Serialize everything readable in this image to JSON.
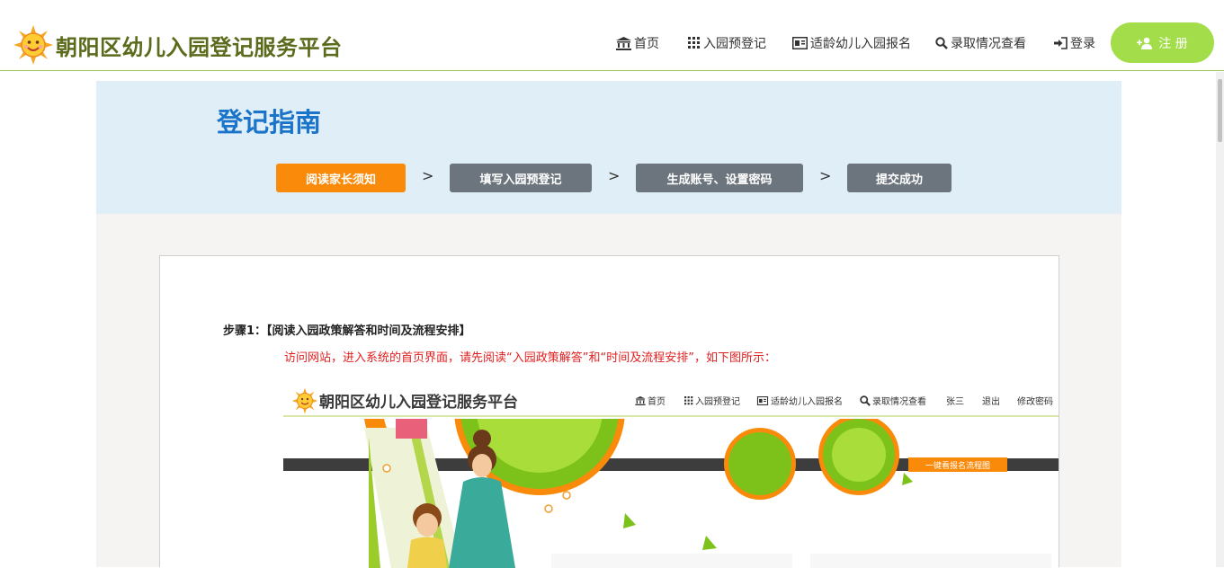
{
  "header": {
    "site_title": "朝阳区幼儿入园登记服务平台",
    "nav": {
      "home": "首页",
      "pre_register": "入园预登记",
      "age_apply": "适龄幼儿入园报名",
      "admission_query": "录取情况查看",
      "login": "登录",
      "register": "注 册"
    },
    "colors": {
      "title": "#5a6b1c",
      "register_button": "#a3dd4a",
      "divider": "#9ccc5a"
    }
  },
  "guide": {
    "title": "登记指南",
    "steps": [
      {
        "label": "阅读家长须知",
        "state": "active"
      },
      {
        "label": "填写入园预登记",
        "state": "inactive"
      },
      {
        "label": "生成账号、设置密码",
        "state": "inactive"
      },
      {
        "label": "提交成功",
        "state": "inactive"
      }
    ],
    "separator": ">",
    "colors": {
      "active": "#f98a0a",
      "inactive": "#6c757d",
      "title": "#1a74c9"
    }
  },
  "content": {
    "step1_title": "步骤1：【阅读入园政策解答和时间及流程安排】",
    "step1_desc": "访问网站，进入系统的首页界面，请先阅读“入园政策解答”和“时间及流程安排”，如下图所示：",
    "screenshot": {
      "title": "朝阳区幼儿入园登记服务平台",
      "nav": {
        "home": "首页",
        "pre_register": "入园预登记",
        "age_apply": "适龄幼儿入园报名",
        "admission_query": "录取情况查看",
        "user": "张三",
        "logout": "退出",
        "change_password": "修改密码"
      },
      "badge": "一键看报名流程图"
    }
  },
  "icons": {
    "logo": "sun-logo-icon",
    "home": "bank-icon",
    "pre_register": "grid-icon",
    "age_apply": "id-card-icon",
    "query": "search-icon",
    "login": "sign-in-icon",
    "register": "add-user-icon"
  }
}
